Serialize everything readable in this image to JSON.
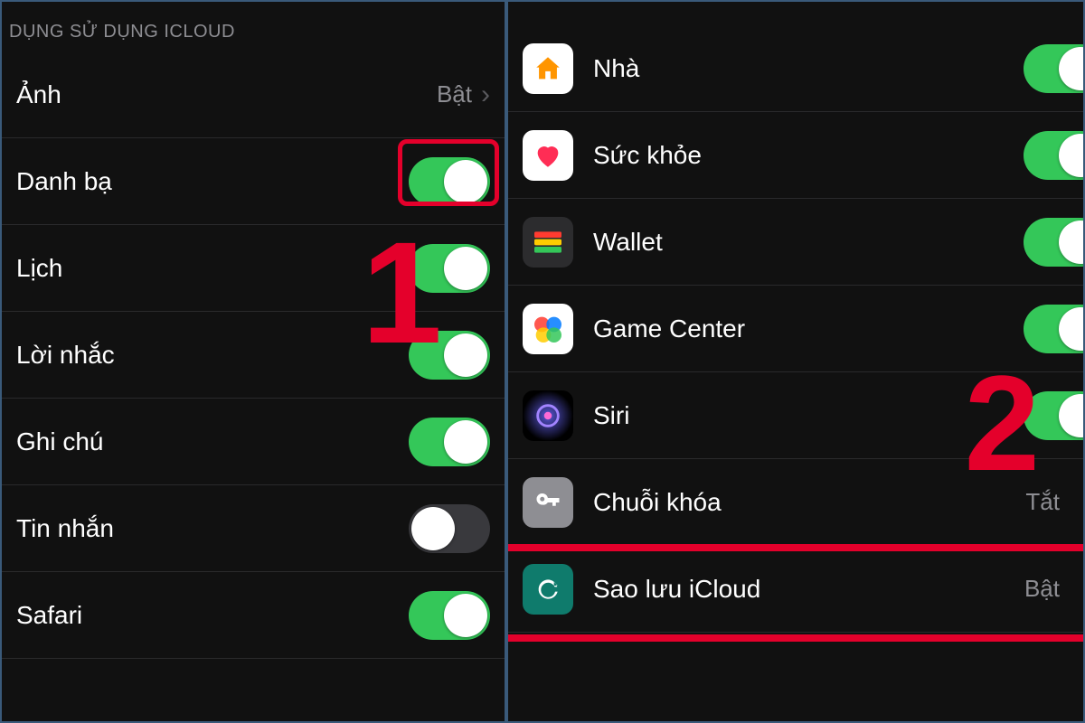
{
  "left": {
    "section_header": "DỤNG SỬ DỤNG ICLOUD",
    "rows": [
      {
        "label": "Ảnh",
        "kind": "link",
        "value": "Bật"
      },
      {
        "label": "Danh bạ",
        "kind": "toggle",
        "on": true,
        "highlight": true
      },
      {
        "label": "Lịch",
        "kind": "toggle",
        "on": true
      },
      {
        "label": "Lời nhắc",
        "kind": "toggle",
        "on": true
      },
      {
        "label": "Ghi chú",
        "kind": "toggle",
        "on": true
      },
      {
        "label": "Tin nhắn",
        "kind": "toggle",
        "on": false
      },
      {
        "label": "Safari",
        "kind": "toggle",
        "on": true
      }
    ],
    "step_number": "1"
  },
  "right": {
    "rows": [
      {
        "icon": "home-icon",
        "icon_glyph": "⌂",
        "icon_class": "ic-home",
        "label": "Nhà",
        "kind": "toggle",
        "on": true
      },
      {
        "icon": "health-icon",
        "icon_glyph": "♥",
        "icon_class": "ic-health",
        "label": "Sức khỏe",
        "kind": "toggle",
        "on": true
      },
      {
        "icon": "wallet-icon",
        "icon_glyph": "▭",
        "icon_class": "ic-wallet",
        "label": "Wallet",
        "kind": "toggle",
        "on": true
      },
      {
        "icon": "gamecenter-icon",
        "icon_glyph": "●",
        "icon_class": "ic-gamecenter",
        "label": "Game Center",
        "kind": "toggle",
        "on": true
      },
      {
        "icon": "siri-icon",
        "icon_glyph": "◉",
        "icon_class": "ic-siri",
        "label": "Siri",
        "kind": "toggle",
        "on": true
      },
      {
        "icon": "keychain-icon",
        "icon_glyph": "⚿",
        "icon_class": "ic-keychain",
        "label": "Chuỗi khóa",
        "kind": "link",
        "value": "Tắt"
      },
      {
        "icon": "backup-icon",
        "icon_glyph": "↻",
        "icon_class": "ic-backup",
        "label": "Sao lưu iCloud",
        "kind": "link",
        "value": "Bật",
        "highlight": true
      }
    ],
    "step_number": "2"
  },
  "colors": {
    "accent_green": "#34c759",
    "highlight_red": "#e4002b",
    "bg": "#111111",
    "text_secondary": "#8e8e93"
  }
}
